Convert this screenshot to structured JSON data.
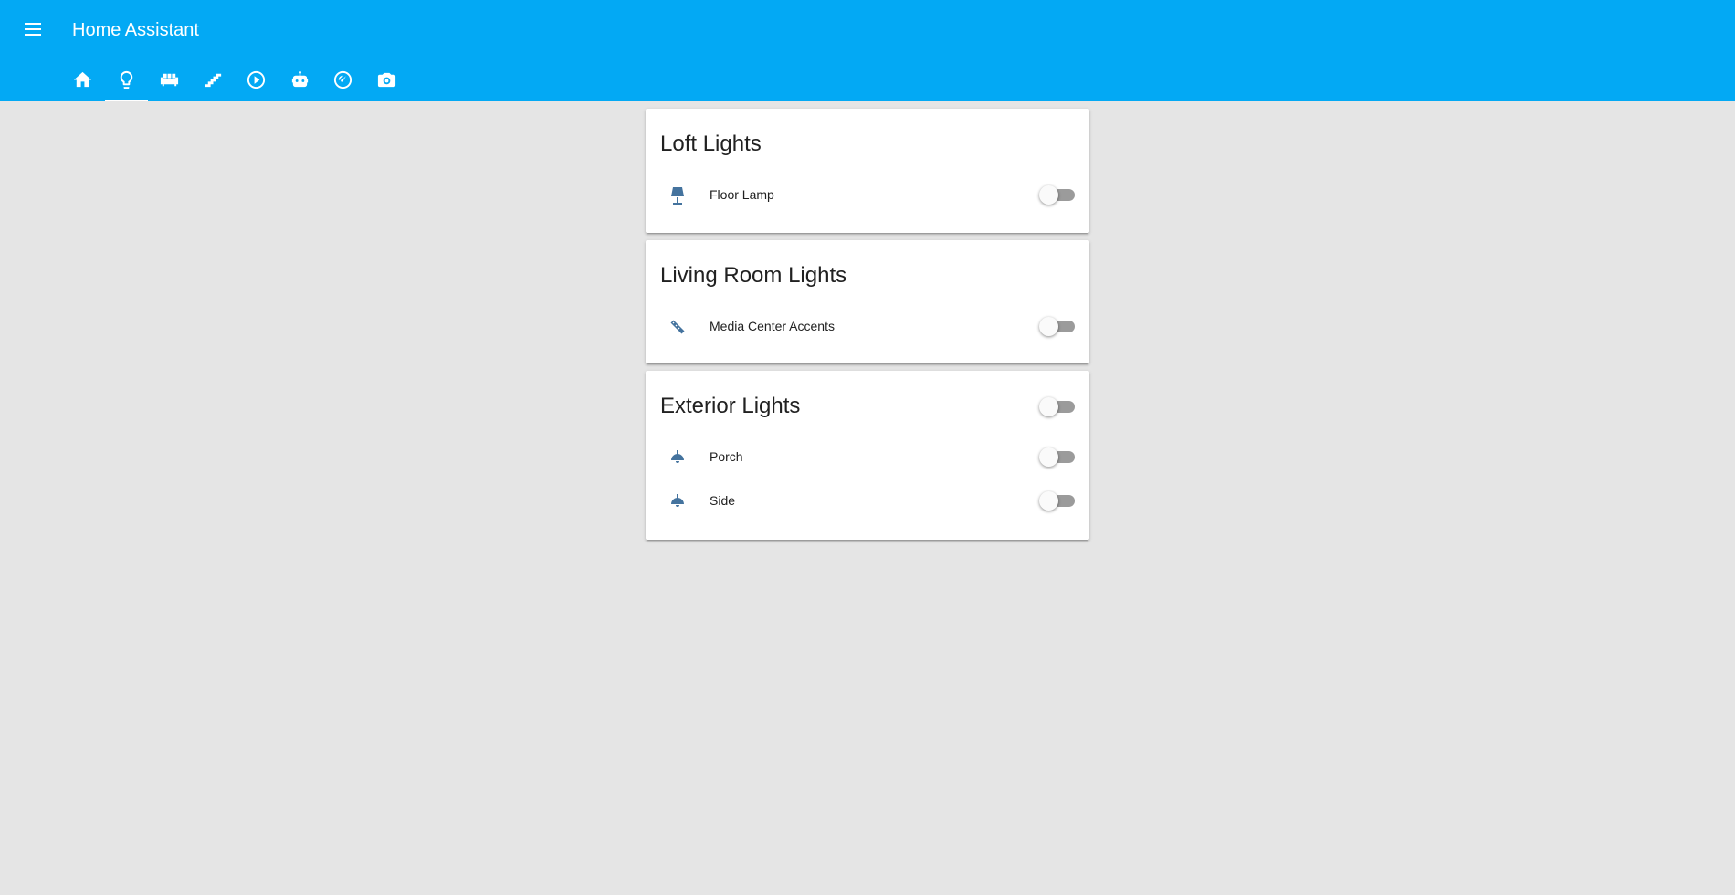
{
  "app": {
    "title": "Home Assistant"
  },
  "header": {
    "menu_icon": "menu-icon",
    "tabs": [
      {
        "icon": "home-icon",
        "active": false
      },
      {
        "icon": "lightbulb-icon",
        "active": true
      },
      {
        "icon": "sofa-icon",
        "active": false
      },
      {
        "icon": "stairs-icon",
        "active": false
      },
      {
        "icon": "play-circle-icon",
        "active": false
      },
      {
        "icon": "robot-icon",
        "active": false
      },
      {
        "icon": "gauge-icon",
        "active": false
      },
      {
        "icon": "camera-icon",
        "active": false
      }
    ]
  },
  "cards": [
    {
      "title": "Loft Lights",
      "has_header_toggle": false,
      "entities": [
        {
          "name": "Floor Lamp",
          "icon": "floor-lamp-icon",
          "state": "off"
        }
      ]
    },
    {
      "title": "Living Room Lights",
      "has_header_toggle": false,
      "entities": [
        {
          "name": "Media Center Accents",
          "icon": "led-strip-icon",
          "state": "off"
        }
      ]
    },
    {
      "title": "Exterior Lights",
      "has_header_toggle": true,
      "header_toggle_state": "off",
      "entities": [
        {
          "name": "Porch",
          "icon": "ceiling-light-icon",
          "state": "off"
        },
        {
          "name": "Side",
          "icon": "ceiling-light-icon",
          "state": "off"
        }
      ]
    }
  ],
  "colors": {
    "toolbar": "#03a9f4",
    "background": "#e5e5e5",
    "entity_icon": "#44739e",
    "toggle_track_off": "#9b9b9b",
    "toggle_knob_off": "#fafafa"
  }
}
